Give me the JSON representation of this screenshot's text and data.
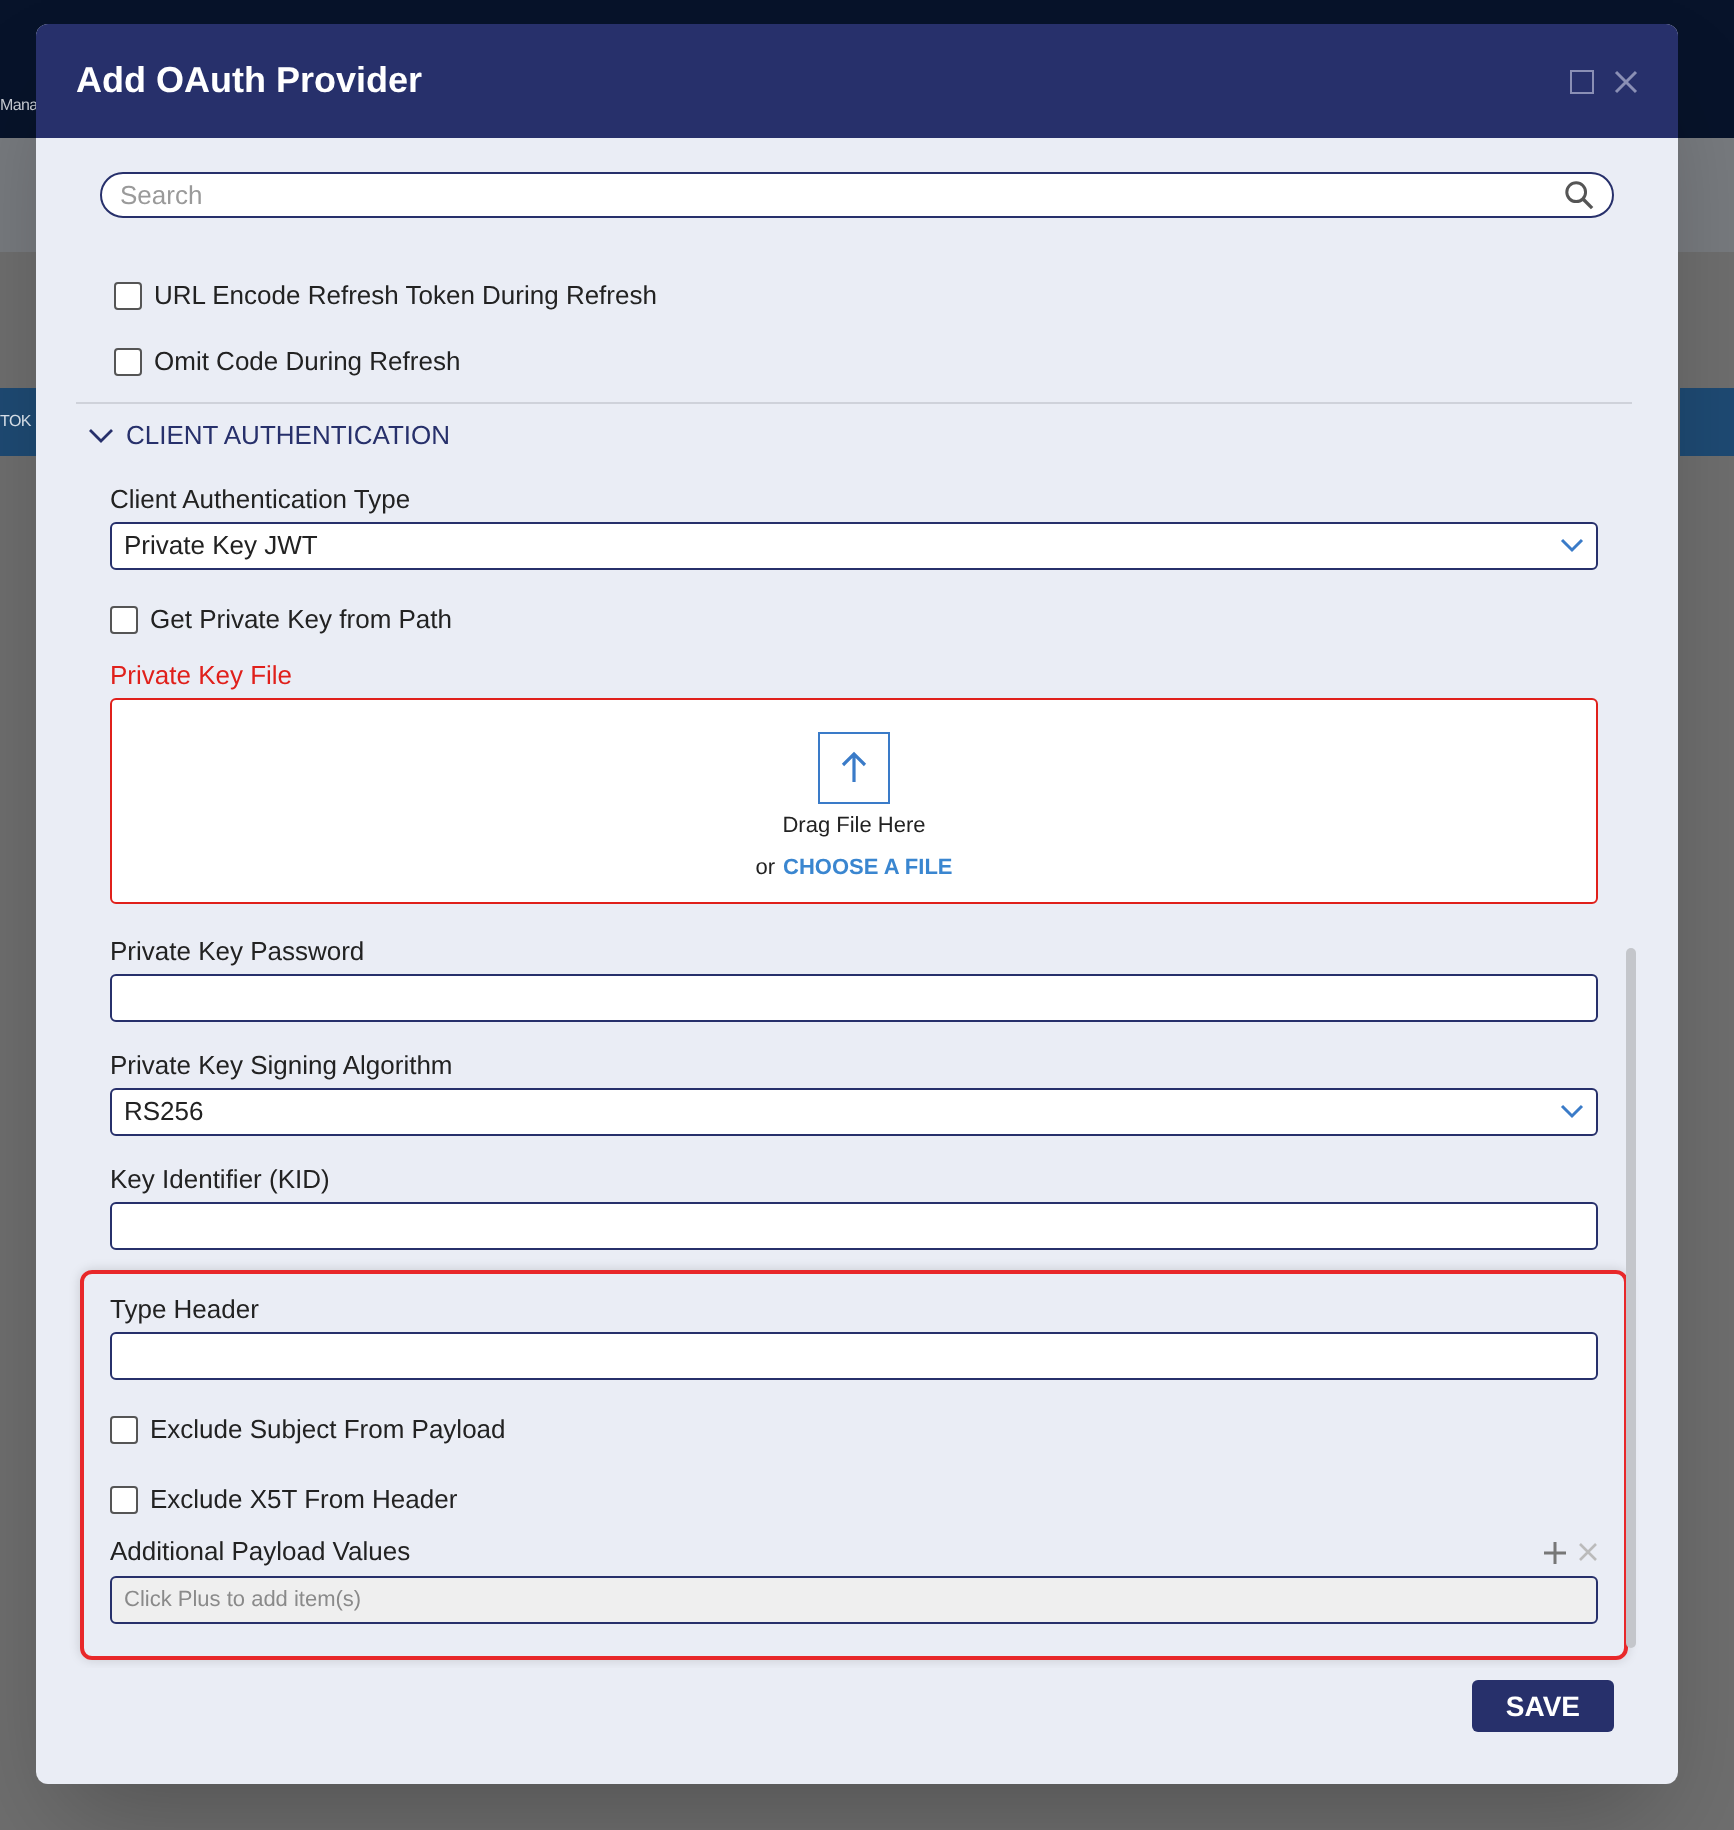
{
  "background": {
    "header_fragment": "Mana",
    "tab_fragment": "TOK"
  },
  "window": {
    "title": "Add OAuth Provider"
  },
  "search": {
    "placeholder": "Search"
  },
  "top_items": [
    {
      "kind": "checkbox",
      "label": "URL Encode Refresh Token During Refresh",
      "checked": false
    },
    {
      "kind": "checkbox",
      "label": "Omit Code During Refresh",
      "checked": false
    }
  ],
  "section": {
    "title": "CLIENT AUTHENTICATION",
    "expanded": true,
    "fields": [
      {
        "kind": "select",
        "label": "Client Authentication Type",
        "value": "Private Key JWT"
      },
      {
        "kind": "checkbox",
        "label": "Get Private Key from Path",
        "checked": false
      },
      {
        "kind": "file",
        "label": "Private Key File",
        "required_error": true,
        "hint": "Drag File Here",
        "or_text": "or",
        "link": "CHOOSE A FILE"
      },
      {
        "kind": "text",
        "label": "Private Key Password"
      },
      {
        "kind": "select",
        "label": "Private Key Signing Algorithm",
        "value": "RS256"
      },
      {
        "kind": "text",
        "label": "Key Identifier (KID)"
      }
    ],
    "highlighted_fields": [
      {
        "kind": "text",
        "label": "Type Header"
      },
      {
        "kind": "checkbox",
        "label": "Exclude Subject From Payload",
        "checked": false
      },
      {
        "kind": "checkbox",
        "label": "Exclude X5T From Header",
        "checked": false
      },
      {
        "kind": "list",
        "label": "Additional Payload Values",
        "placeholder": "Click Plus to add item(s)"
      }
    ]
  },
  "buttons": [
    {
      "label": "SAVE"
    }
  ]
}
